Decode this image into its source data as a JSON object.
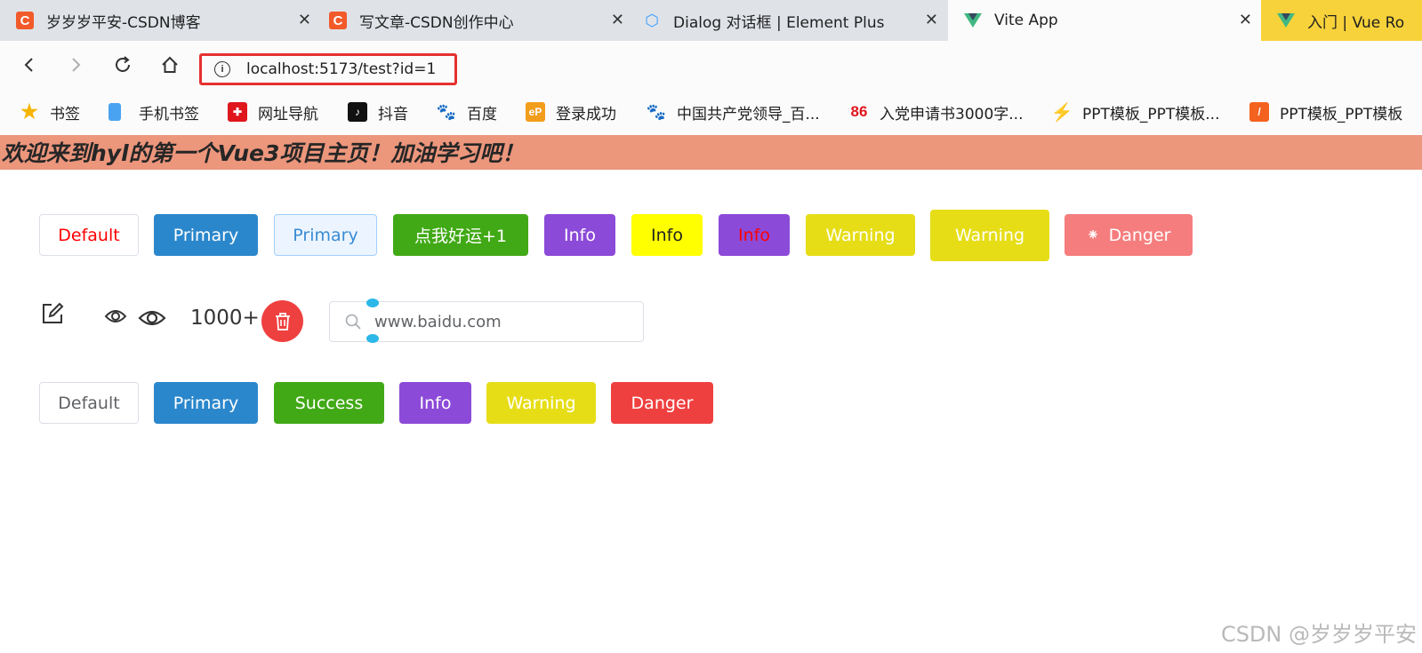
{
  "browser": {
    "tabs": [
      {
        "title": "岁岁岁平安-CSDN博客",
        "favicon": "csdn-icon",
        "active": false
      },
      {
        "title": "写文章-CSDN创作中心",
        "favicon": "csdn-icon",
        "active": false
      },
      {
        "title": "Dialog 对话框 | Element Plus",
        "favicon": "element-plus-icon",
        "active": false
      },
      {
        "title": "Vite App",
        "favicon": "vue-icon",
        "active": true
      },
      {
        "title": "入门 | Vue Ro",
        "favicon": "vue-icon",
        "active": false
      }
    ],
    "url": "localhost:5173/test?id=1",
    "bookmarks": [
      {
        "label": "书签",
        "icon": "star-icon"
      },
      {
        "label": "手机书签",
        "icon": "phone-icon"
      },
      {
        "label": "网址导航",
        "icon": "nav-site-icon"
      },
      {
        "label": "抖音",
        "icon": "douyin-icon"
      },
      {
        "label": "百度",
        "icon": "baidu-icon"
      },
      {
        "label": "登录成功",
        "icon": "ep-icon"
      },
      {
        "label": "中国共产党领导_百...",
        "icon": "baidu-icon"
      },
      {
        "label": "入党申请书3000字...",
        "icon": "86-icon"
      },
      {
        "label": "PPT模板_PPT模板...",
        "icon": "ppt-icon"
      },
      {
        "label": "PPT模板_PPT模板",
        "icon": "ppt-orange-icon"
      }
    ]
  },
  "page": {
    "banner_title": "欢迎来到hyl的第一个Vue3项目主页！加油学习吧！",
    "row1_buttons": [
      "Default",
      "Primary",
      "Primary",
      "点我好运+1",
      "Info",
      "Info",
      "Info",
      "Warning",
      "Warning",
      "Danger"
    ],
    "badge_count": "1000+",
    "search": {
      "value": "www.baidu.com"
    },
    "row3_buttons": [
      "Default",
      "Primary",
      "Success",
      "Info",
      "Warning",
      "Danger"
    ],
    "watermark": "CSDN @岁岁岁平安"
  },
  "colors": {
    "banner": "#ec967c",
    "primary": "#2b87cc",
    "success": "#41a916",
    "info": "#8c4ad8",
    "warning": "#e6dd17",
    "danger": "#ef4040",
    "highlight_border": "#e5312f"
  }
}
